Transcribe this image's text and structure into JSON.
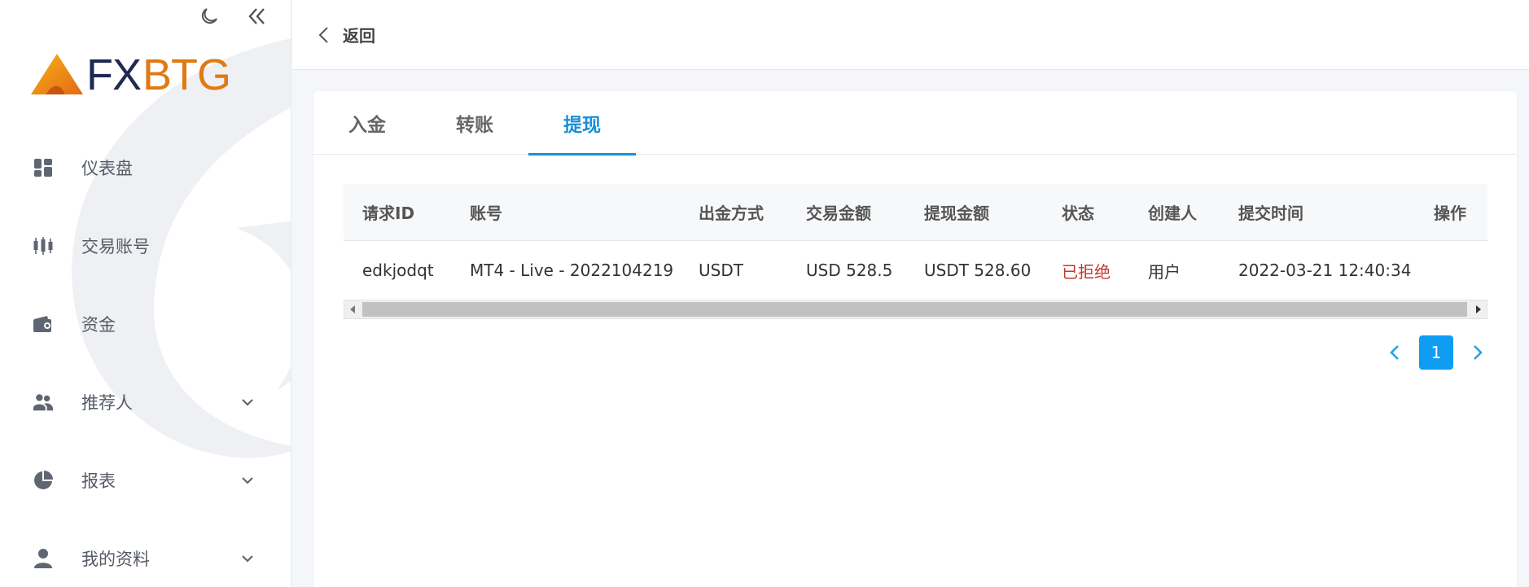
{
  "brand": {
    "fx": "FX",
    "btg": "BTG"
  },
  "sidebar": {
    "items": [
      {
        "label": "仪表盘",
        "icon": "dashboard-icon",
        "has_children": false
      },
      {
        "label": "交易账号",
        "icon": "candlestick-icon",
        "has_children": false
      },
      {
        "label": "资金",
        "icon": "wallet-icon",
        "has_children": false
      },
      {
        "label": "推荐人",
        "icon": "users-icon",
        "has_children": true
      },
      {
        "label": "报表",
        "icon": "pie-chart-icon",
        "has_children": true
      },
      {
        "label": "我的资料",
        "icon": "user-icon",
        "has_children": true
      }
    ]
  },
  "header": {
    "back_label": "返回"
  },
  "tabs": [
    {
      "label": "入金",
      "active": false
    },
    {
      "label": "转账",
      "active": false
    },
    {
      "label": "提现",
      "active": true
    }
  ],
  "table": {
    "columns": [
      "请求ID",
      "账号",
      "出金方式",
      "交易金额",
      "提现金额",
      "状态",
      "创建人",
      "提交时间",
      "操作"
    ],
    "rows": [
      [
        "edkjodqt",
        "MT4 - Live - 2022104219",
        "USDT",
        "USD 528.5",
        "USDT 528.60",
        "已拒绝",
        "用户",
        "2022-03-21 12:40:34",
        ""
      ]
    ]
  },
  "pagination": {
    "current": "1"
  },
  "colors": {
    "accent": "#1a8fd8",
    "page_active": "#0f9cf3",
    "rejected": "#c0392b",
    "brand_orange": "#e07a15",
    "brand_navy": "#1e2a52"
  }
}
